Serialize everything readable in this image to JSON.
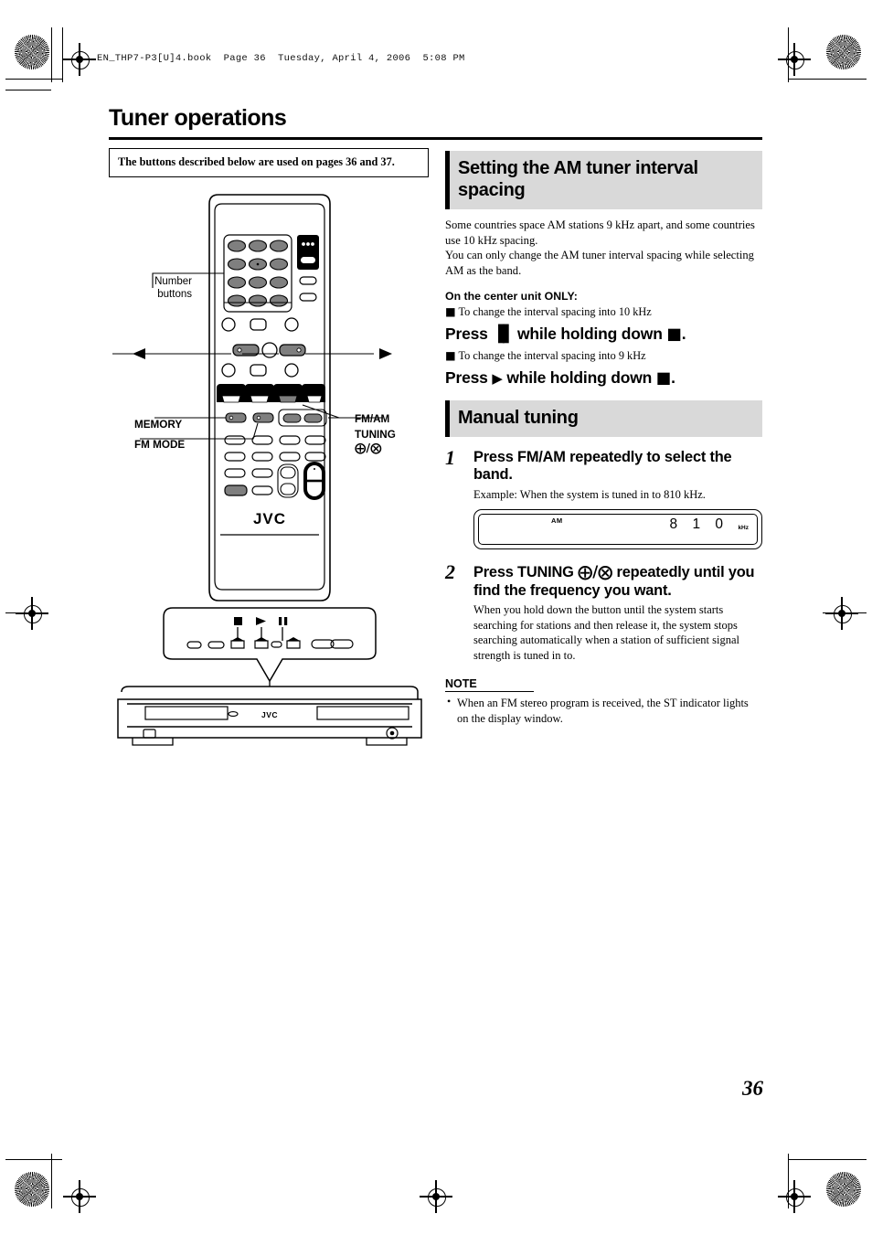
{
  "header": {
    "file_line": "EN_THP7-P3[U]4.book  Page 36  Tuesday, April 4, 2006  5:08 PM"
  },
  "page": {
    "title": "Tuner operations",
    "number": "36"
  },
  "left_column": {
    "callout_box": "The buttons described below are used on pages 36 and 37.",
    "diagram_labels": {
      "number_buttons": "Number\nbuttons",
      "memory": "MEMORY",
      "fm_mode": "FM MODE",
      "fm_am": "FM/AM",
      "tuning": "TUNING",
      "tuning_symbols": "⊕/⊖",
      "brand": "JVC",
      "unit_brand": "JVC"
    },
    "unit_callout_icons": [
      "stop-square",
      "play-triangle",
      "pause-bars"
    ]
  },
  "right_column": {
    "section1": {
      "heading": "Setting the AM tuner interval spacing",
      "paragraph1": "Some countries space AM stations 9 kHz apart, and some countries use 10 kHz spacing.",
      "paragraph2": "You can only change the AM tuner interval spacing while selecting AM as the band.",
      "subheading": "On the center unit ONLY:",
      "bullet1": "To change the interval spacing into 10 kHz",
      "press1_prefix": "Press",
      "press1_symbol": "▐▌",
      "press1_suffix": "while holding down",
      "press1_end": ".",
      "bullet2": "To change the interval spacing into 9 kHz",
      "press2_prefix": "Press",
      "press2_symbol": "▶",
      "press2_suffix": "while holding down",
      "press2_end": "."
    },
    "section2": {
      "heading": "Manual tuning",
      "steps": [
        {
          "number": "1",
          "title": "Press FM/AM repeatedly to select the band.",
          "body": "Example: When the system is tuned in to 810 kHz."
        },
        {
          "number": "2",
          "title_part1": "Press TUNING",
          "title_symbols": "⊕/⊖",
          "title_part2": "repeatedly until you find the frequency you want.",
          "body": "When you hold down the button until the system starts searching for stations and then release it, the system stops searching automatically when a station of sufficient signal strength is tuned in to."
        }
      ],
      "display_window": {
        "band": "AM",
        "frequency": "8 1 0",
        "unit": "kHz"
      }
    },
    "note": {
      "heading": "NOTE",
      "items": [
        "When an FM stereo program is received, the ST indicator lights on the display window."
      ]
    }
  },
  "colors": {
    "section_heading_bg": "#d9d9d9",
    "accent_bar": "#000000",
    "button_gray": "#7f7f7f",
    "page_bg": "#ffffff"
  }
}
